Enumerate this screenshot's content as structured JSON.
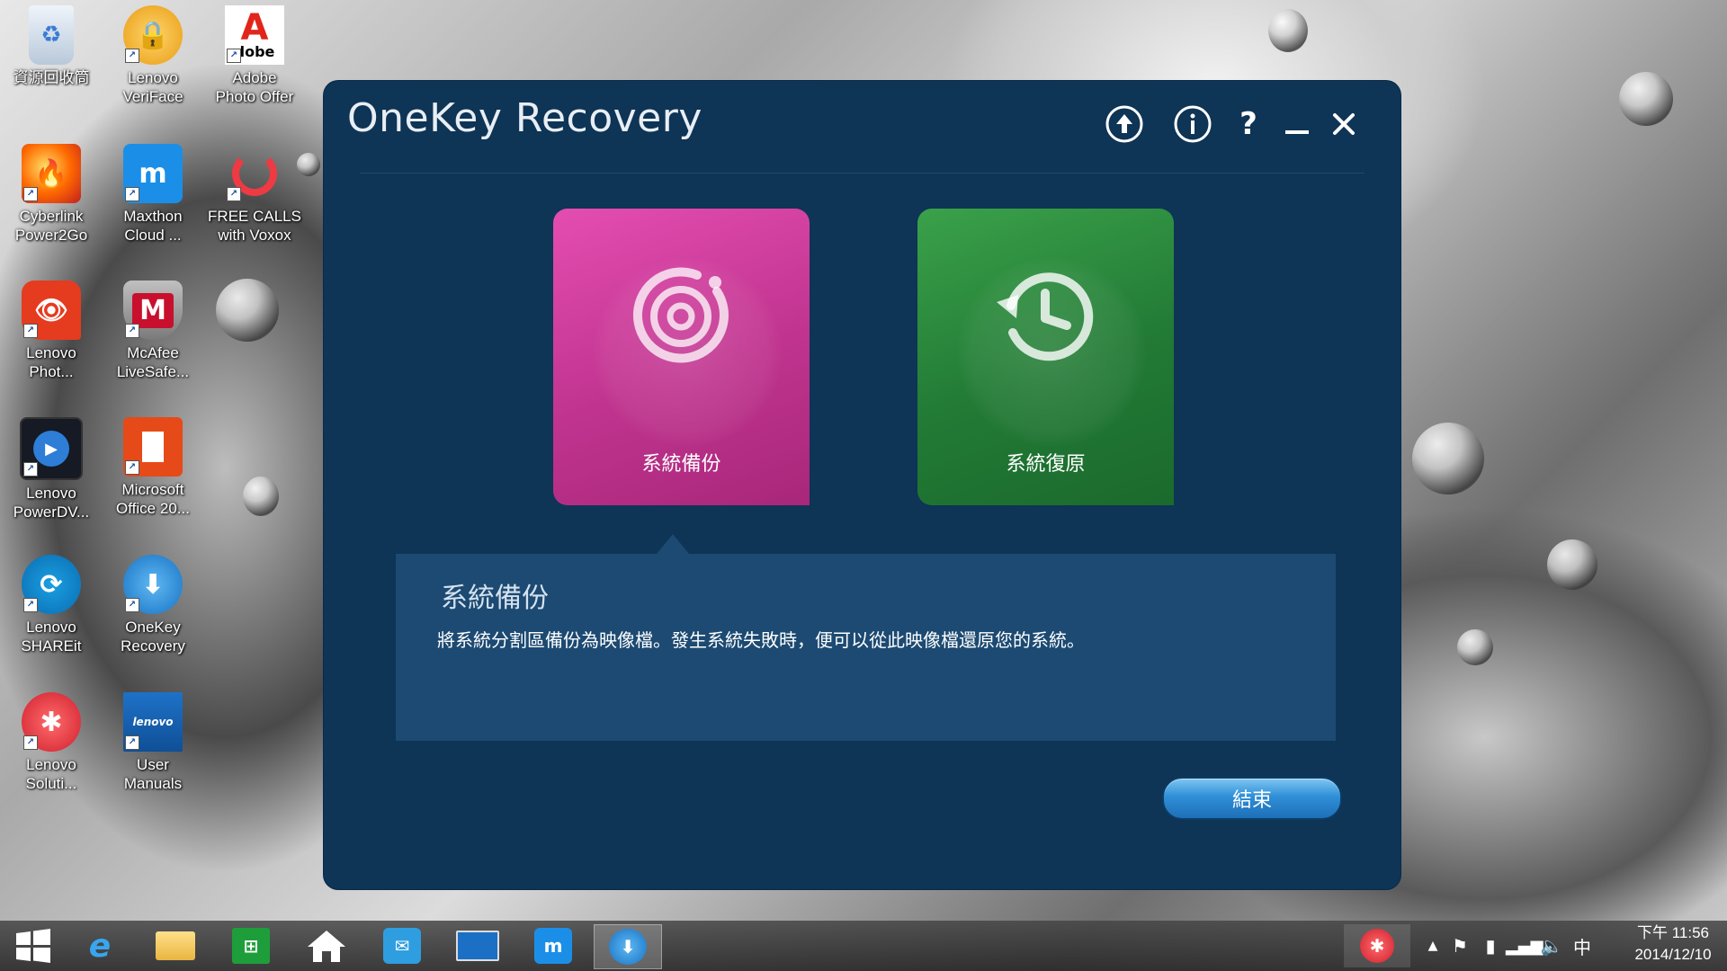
{
  "desktop": {
    "icons": [
      {
        "label": "資源回收筒",
        "icon": "recycle-bin-icon"
      },
      {
        "label": "Lenovo\nVeriFace",
        "icon": "veriface-icon"
      },
      {
        "label": "Adobe\nPhoto Offer",
        "icon": "adobe-icon"
      },
      {
        "label": "Cyberlink\nPower2Go",
        "icon": "power2go-icon"
      },
      {
        "label": "Maxthon\nCloud ...",
        "icon": "maxthon-icon"
      },
      {
        "label": "FREE CALLS\nwith Voxox",
        "icon": "voxox-icon"
      },
      {
        "label": "Lenovo\nPhot...",
        "icon": "lenovo-photo-icon"
      },
      {
        "label": "McAfee\nLiveSafe...",
        "icon": "mcafee-icon"
      },
      {
        "label": "Lenovo\nPowerDV...",
        "icon": "powerdvd-icon"
      },
      {
        "label": "Microsoft\nOffice 20...",
        "icon": "office-icon"
      },
      {
        "label": "Lenovo\nSHAREit",
        "icon": "shareit-icon"
      },
      {
        "label": "OneKey\nRecovery",
        "icon": "onekey-recovery-icon"
      },
      {
        "label": "Lenovo\nSoluti...",
        "icon": "lenovo-solution-icon"
      },
      {
        "label": "User\nManuals",
        "icon": "user-manuals-icon"
      }
    ],
    "adobe_badge": "dobe"
  },
  "window": {
    "title": "OneKey Recovery",
    "controls": {
      "update": "upload-icon",
      "info": "info-icon",
      "help": "?",
      "minimize": "minimize-icon",
      "close": "close-icon"
    },
    "tiles": [
      {
        "label": "系統備份",
        "icon": "disc-backup-icon",
        "color": "#c0348f"
      },
      {
        "label": "系統復原",
        "icon": "clock-restore-icon",
        "color": "#227a35"
      }
    ],
    "info_panel": {
      "title": "系統備份",
      "description": "將系統分割區備份為映像檔。發生系統失敗時，便可以從此映像檔還原您的系統。"
    },
    "end_button": "結束"
  },
  "taskbar": {
    "items": [
      "start-icon",
      "internet-explorer-icon",
      "file-explorer-icon",
      "store-icon",
      "home-icon",
      "mail-icon",
      "lenovo-monitor-icon",
      "maxthon-icon",
      "onekey-recovery-icon"
    ],
    "tray": {
      "ime": "中",
      "icons": [
        "show-hidden-icon",
        "flag-icon",
        "power-icon",
        "signal-icon",
        "volume-icon"
      ]
    },
    "clock": {
      "time": "下午 11:56",
      "date": "2014/12/10"
    },
    "badge_app": "lenovo-solution-icon"
  },
  "colors": {
    "window_bg": "#0e3456",
    "info_bg": "#1c4a72",
    "backup_tile": "#c0348f",
    "restore_tile": "#227a35",
    "end_button": "#2f8fd7"
  }
}
